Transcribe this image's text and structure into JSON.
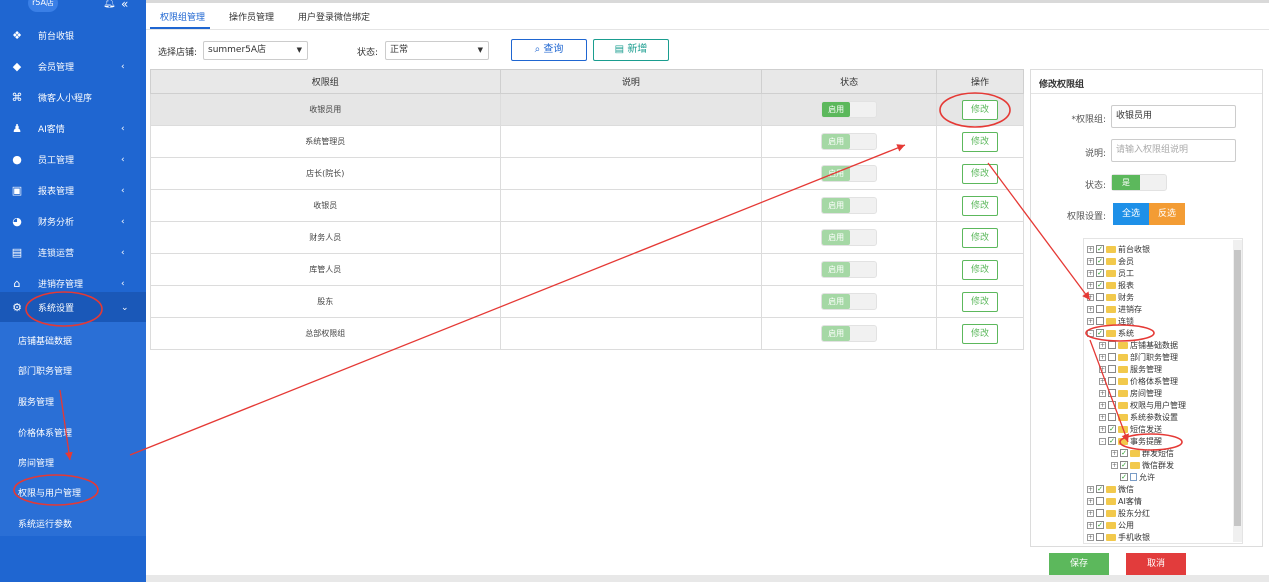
{
  "sidebar": {
    "store_avatar": "r5A店",
    "items": [
      {
        "label": "前台收银",
        "has_submenu": false
      },
      {
        "label": "会员管理",
        "has_submenu": true
      },
      {
        "label": "微客人小程序",
        "has_submenu": false
      },
      {
        "label": "AI客情",
        "has_submenu": true
      },
      {
        "label": "员工管理",
        "has_submenu": true
      },
      {
        "label": "报表管理",
        "has_submenu": true
      },
      {
        "label": "财务分析",
        "has_submenu": true
      },
      {
        "label": "连锁运营",
        "has_submenu": true
      },
      {
        "label": "进销存管理",
        "has_submenu": true
      },
      {
        "label": "系统设置",
        "has_submenu": true,
        "expanded": true
      }
    ],
    "submenu": [
      "店铺基础数据",
      "部门职务管理",
      "服务管理",
      "价格体系管理",
      "房间管理",
      "权限与用户管理",
      "系统运行参数"
    ]
  },
  "tabs": [
    "权限组管理",
    "操作员管理",
    "用户登录微信绑定"
  ],
  "filter": {
    "store_label": "选择店铺:",
    "store_value": "summer5A店",
    "status_label": "状态:",
    "status_value": "正常",
    "query_button": "查询",
    "add_button": "新增"
  },
  "table": {
    "columns": [
      "权限组",
      "说明",
      "状态",
      "操作"
    ],
    "rows": [
      {
        "name": "收银员用",
        "desc": "",
        "status": "启用",
        "action": "修改"
      },
      {
        "name": "系统管理员",
        "desc": "",
        "status": "启用",
        "action": "修改"
      },
      {
        "name": "店长(院长)",
        "desc": "",
        "status": "启用",
        "action": "修改"
      },
      {
        "name": "收银员",
        "desc": "",
        "status": "启用",
        "action": "修改"
      },
      {
        "name": "财务人员",
        "desc": "",
        "status": "启用",
        "action": "修改"
      },
      {
        "name": "库管人员",
        "desc": "",
        "status": "启用",
        "action": "修改"
      },
      {
        "name": "股东",
        "desc": "",
        "status": "启用",
        "action": "修改"
      },
      {
        "name": "总部权限组",
        "desc": "",
        "status": "启用",
        "action": "修改"
      }
    ]
  },
  "panel": {
    "title": "修改权限组",
    "group_label": "*权限组:",
    "group_value": "收银员用",
    "desc_label": "说明:",
    "desc_placeholder": "请输入权限组说明",
    "status_label": "状态:",
    "status_value": "是",
    "perm_label": "权限设置:",
    "select_all": "全选",
    "invert": "反选",
    "save": "保存",
    "cancel": "取消"
  },
  "tree": [
    {
      "label": "前台收银",
      "level": 0,
      "checked": true,
      "exp": "+"
    },
    {
      "label": "会员",
      "level": 0,
      "checked": true,
      "exp": "+"
    },
    {
      "label": "员工",
      "level": 0,
      "checked": true,
      "exp": "+"
    },
    {
      "label": "报表",
      "level": 0,
      "checked": true,
      "exp": "+"
    },
    {
      "label": "财务",
      "level": 0,
      "checked": false,
      "exp": "+"
    },
    {
      "label": "进销存",
      "level": 0,
      "checked": false,
      "exp": "+"
    },
    {
      "label": "连锁",
      "level": 0,
      "checked": false,
      "exp": "+"
    },
    {
      "label": "系统",
      "level": 0,
      "checked": true,
      "exp": "-"
    },
    {
      "label": "店铺基础数据",
      "level": 1,
      "checked": false,
      "exp": "+"
    },
    {
      "label": "部门职务管理",
      "level": 1,
      "checked": false,
      "exp": "+"
    },
    {
      "label": "服务管理",
      "level": 1,
      "checked": false,
      "exp": "+"
    },
    {
      "label": "价格体系管理",
      "level": 1,
      "checked": false,
      "exp": "+"
    },
    {
      "label": "房间管理",
      "level": 1,
      "checked": false,
      "exp": "+"
    },
    {
      "label": "权限与用户管理",
      "level": 1,
      "checked": false,
      "exp": "+"
    },
    {
      "label": "系统参数设置",
      "level": 1,
      "checked": false,
      "exp": "+"
    },
    {
      "label": "短信发送",
      "level": 1,
      "checked": true,
      "exp": "+"
    },
    {
      "label": "事务提醒",
      "level": 1,
      "checked": true,
      "exp": "-"
    },
    {
      "label": "群发短信",
      "level": 2,
      "checked": true,
      "exp": "+"
    },
    {
      "label": "微信群发",
      "level": 2,
      "checked": true,
      "exp": "+"
    },
    {
      "label": "允许",
      "level": 2,
      "checked": true,
      "exp": "",
      "file": true
    },
    {
      "label": "微信",
      "level": 0,
      "checked": true,
      "exp": "+"
    },
    {
      "label": "AI客情",
      "level": 0,
      "checked": false,
      "exp": "+"
    },
    {
      "label": "股东分红",
      "level": 0,
      "checked": false,
      "exp": "+"
    },
    {
      "label": "公用",
      "level": 0,
      "checked": true,
      "exp": "+"
    },
    {
      "label": "手机收银",
      "level": 0,
      "checked": false,
      "exp": "+"
    }
  ],
  "colors": {
    "sidebar": "#1f66d1",
    "accent": "#1f66d1",
    "success": "#5cb85c",
    "danger": "#e23c3c",
    "annotation": "#e53935"
  }
}
